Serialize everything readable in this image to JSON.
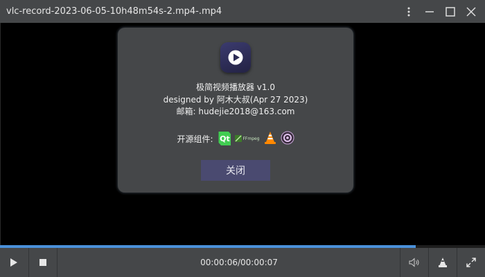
{
  "window": {
    "title": "vlc-record-2023-06-05-10h48m54s-2.mp4-.mp4",
    "buttons": [
      "more-options",
      "minimize",
      "maximize",
      "close"
    ]
  },
  "about_dialog": {
    "app_name": "极简视频播放器 v1.0",
    "designed_by": "designed by 阿木大叔(Apr 27 2023)",
    "email": "邮箱: hudejie2018@163.com",
    "oss_label": "开源组件:",
    "oss_components": [
      "Qt",
      "FFmpeg",
      "VLC",
      "OBS"
    ],
    "oss_icons": [
      "qt-logo-icon",
      "ffmpeg-logo-icon",
      "vlc-cone-icon",
      "obs-logo-icon"
    ],
    "ffmpeg_text": "FFmpeg",
    "qt_text": "Qt",
    "close_label": "关闭"
  },
  "player": {
    "progress_fraction": 0.857,
    "time_display": "00:00:06/00:00:07",
    "accent_color": "#4a90d9"
  }
}
